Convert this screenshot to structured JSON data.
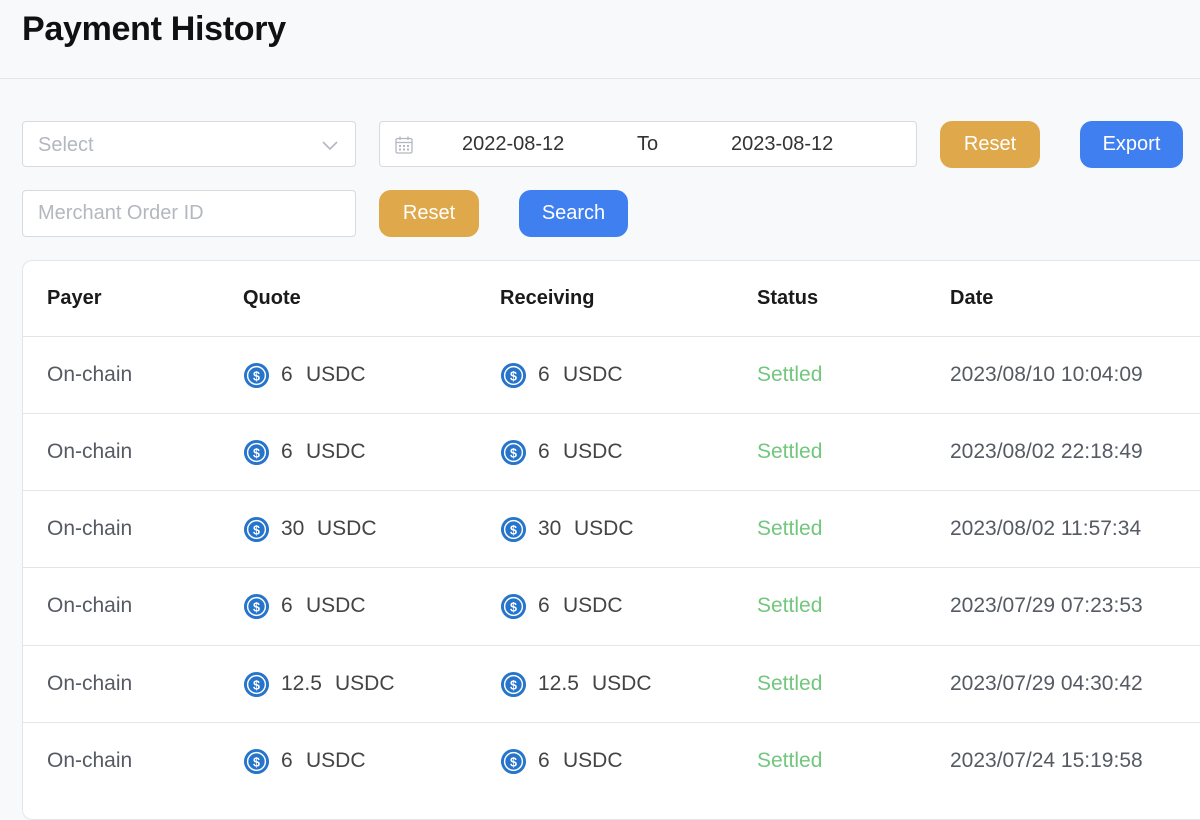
{
  "page": {
    "title": "Payment History"
  },
  "filters": {
    "select_placeholder": "Select",
    "date_start": "2022-08-12",
    "date_separator": "To",
    "date_end": "2023-08-12",
    "reset_label": "Reset",
    "export_label": "Export",
    "order_id_placeholder": "Merchant Order ID",
    "reset2_label": "Reset",
    "search_label": "Search"
  },
  "table": {
    "headers": [
      "Payer",
      "Quote",
      "Receiving",
      "Status",
      "Date"
    ],
    "rows": [
      {
        "payer": "On-chain",
        "quote_amount": "6",
        "quote_currency": "USDC",
        "receiving_amount": "6",
        "receiving_currency": "USDC",
        "status": "Settled",
        "date": "2023/08/10 10:04:09"
      },
      {
        "payer": "On-chain",
        "quote_amount": "6",
        "quote_currency": "USDC",
        "receiving_amount": "6",
        "receiving_currency": "USDC",
        "status": "Settled",
        "date": "2023/08/02 22:18:49"
      },
      {
        "payer": "On-chain",
        "quote_amount": "30",
        "quote_currency": "USDC",
        "receiving_amount": "30",
        "receiving_currency": "USDC",
        "status": "Settled",
        "date": "2023/08/02 11:57:34"
      },
      {
        "payer": "On-chain",
        "quote_amount": "6",
        "quote_currency": "USDC",
        "receiving_amount": "6",
        "receiving_currency": "USDC",
        "status": "Settled",
        "date": "2023/07/29 07:23:53"
      },
      {
        "payer": "On-chain",
        "quote_amount": "12.5",
        "quote_currency": "USDC",
        "receiving_amount": "12.5",
        "receiving_currency": "USDC",
        "status": "Settled",
        "date": "2023/07/29 04:30:42"
      },
      {
        "payer": "On-chain",
        "quote_amount": "6",
        "quote_currency": "USDC",
        "receiving_amount": "6",
        "receiving_currency": "USDC",
        "status": "Settled",
        "date": "2023/07/24 15:19:58"
      }
    ]
  },
  "icons": {
    "currency": "usdc-coin-icon",
    "calendar": "calendar-icon",
    "dropdown": "chevron-down-icon"
  },
  "colors": {
    "amber_button": "#dea84b",
    "blue_button": "#3f7ff0",
    "settled_status": "#72c77d",
    "usdc_icon": "#2775ca"
  }
}
